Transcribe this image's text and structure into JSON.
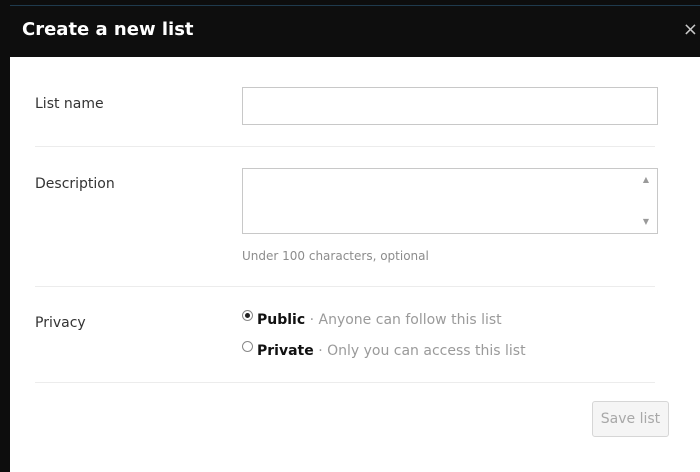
{
  "dialog": {
    "title": "Create a new list",
    "close_glyph": "×"
  },
  "form": {
    "list_name": {
      "label": "List name",
      "value": ""
    },
    "description": {
      "label": "Description",
      "value": "",
      "hint": "Under 100 characters, optional"
    },
    "privacy": {
      "label": "Privacy",
      "options": [
        {
          "name": "Public",
          "description": "· Anyone can follow this list",
          "selected": true
        },
        {
          "name": "Private",
          "description": "· Only you can access this list",
          "selected": false
        }
      ]
    }
  },
  "actions": {
    "save_label": "Save list"
  },
  "icons": [
    "close-icon",
    "scroll-up-arrow-icon",
    "scroll-down-arrow-icon"
  ],
  "colors": {
    "titlebar": "#0e0e0e",
    "title_text": "#ffffff",
    "hint_text": "#8c8c8c",
    "disabled_button_text": "#a8a8a8"
  }
}
